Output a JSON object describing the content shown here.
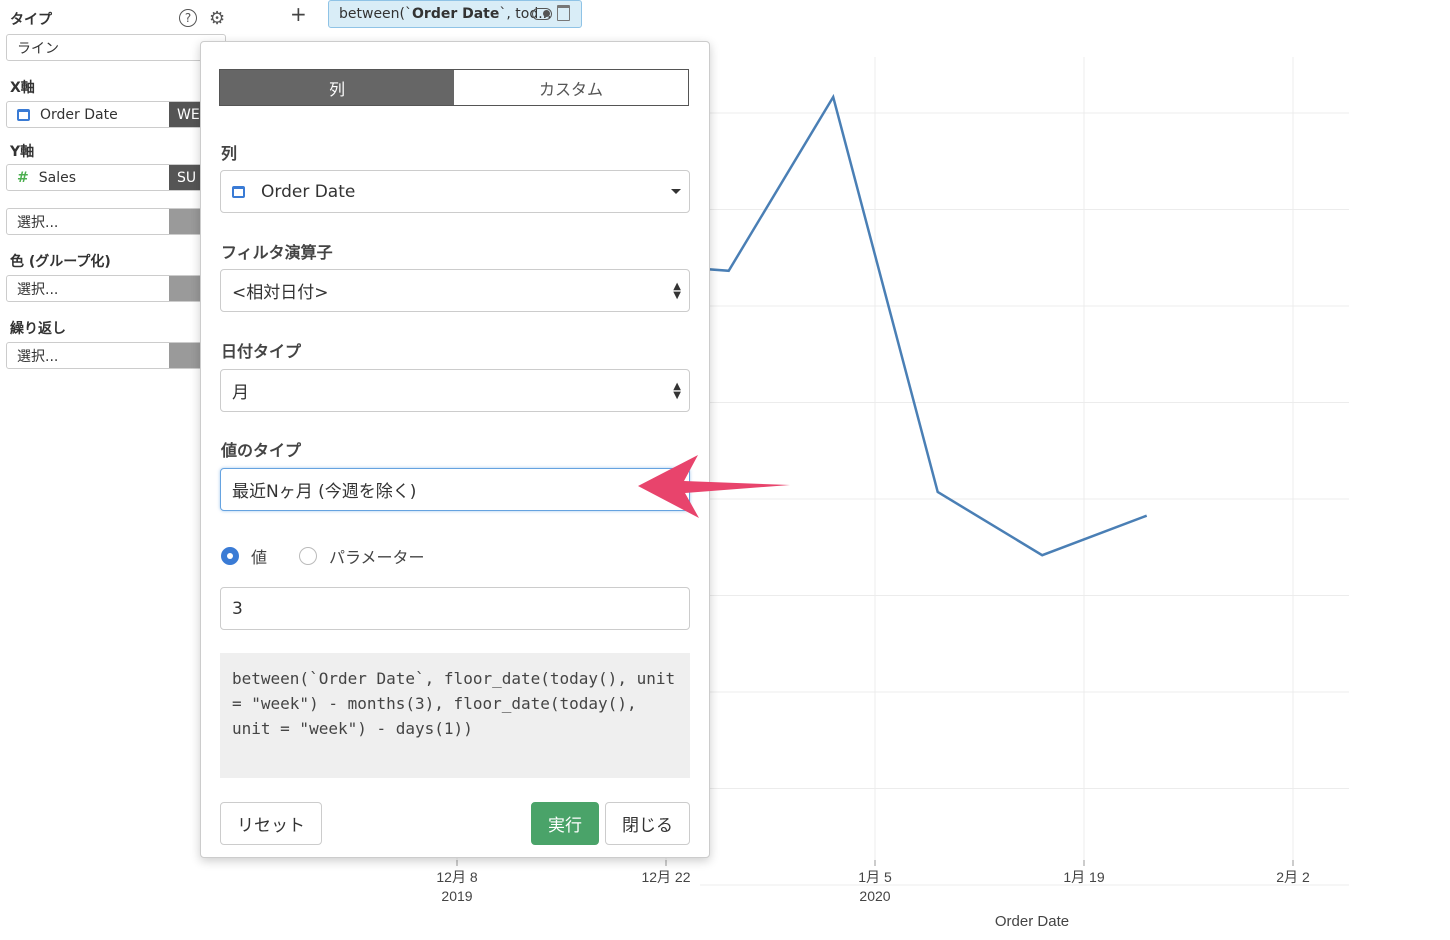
{
  "left_panel": {
    "type_label": "タイプ",
    "type_value": "ライン",
    "x_axis_label": "X軸",
    "x_axis_value": "Order Date",
    "x_axis_suffix": "WE",
    "y_axis_label": "Y軸",
    "y_axis_value": "Sales",
    "y_axis_suffix": "SU",
    "y_extra_value": "選択...",
    "color_label": "色 (グループ化)",
    "color_value": "選択...",
    "repeat_label": "繰り返し",
    "repeat_value": "選択..."
  },
  "filter_chip": {
    "prefix": "between(`",
    "bold": "Order Date",
    "suffix": "`, tod..."
  },
  "popover": {
    "tab_column": "列",
    "tab_custom": "カスタム",
    "column_label": "列",
    "column_value": "Order Date",
    "operator_label": "フィルタ演算子",
    "operator_value": "<相対日付>",
    "date_type_label": "日付タイプ",
    "date_type_value": "月",
    "value_type_label": "値のタイプ",
    "value_type_value": "最近Nヶ月 (今週を除く)",
    "radio_value": "値",
    "radio_param": "パラメーター",
    "input_value": "3",
    "expression": "between(`Order Date`, floor_date(today(), unit = \"week\") - months(3), floor_date(today(), unit = \"week\") - days(1))",
    "reset_label": "リセット",
    "run_label": "実行",
    "close_label": "閉じる"
  },
  "colors": {
    "line": "#4a7fb5",
    "run_button": "#4aa369",
    "arrow": "#e8446c",
    "chip_bg": "#d9edf7"
  },
  "chart_data": {
    "type": "line",
    "xlabel": "Order Date",
    "ticks": [
      {
        "label": "12月 8",
        "year": "2019"
      },
      {
        "label": "12月 22",
        "year": ""
      },
      {
        "label": "1月 5",
        "year": "2020"
      },
      {
        "label": "1月 19",
        "year": ""
      },
      {
        "label": "2月 2",
        "year": ""
      }
    ],
    "x_weeks": [
      -1.0,
      -0.15,
      0.6,
      1.6,
      2.6,
      3.6,
      4.6,
      5.6,
      6.6
    ],
    "y_values": [
      0.61,
      0.47,
      0.36,
      0.79,
      0.78,
      1.0,
      0.5,
      0.42,
      0.47
    ]
  }
}
